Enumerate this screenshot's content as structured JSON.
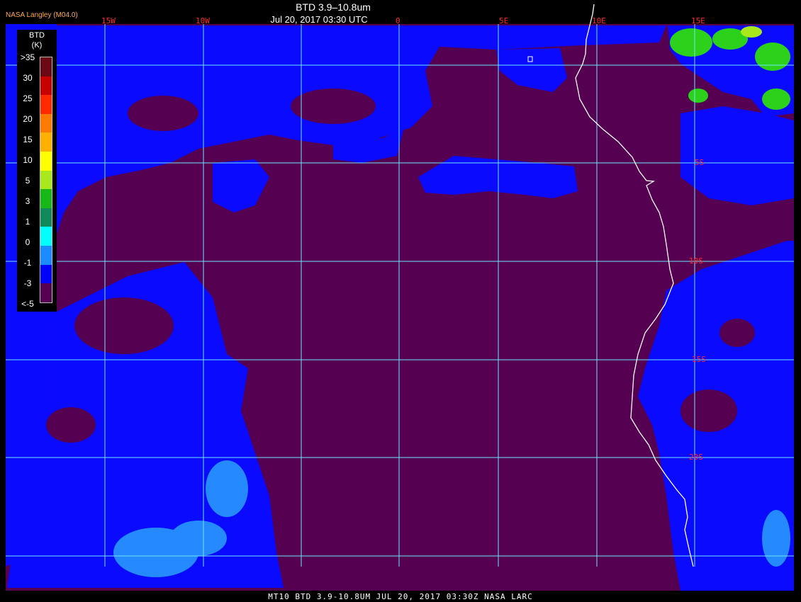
{
  "header": {
    "title": "BTD 3.9–10.8um",
    "subtitle": "Jul 20, 2017 03:30 UTC",
    "credit": "NASA Langley (M04.0)"
  },
  "footer": {
    "text": "MT10  BTD 3.9-10.8UM   JUL 20, 2017 03:30Z   NASA LARC"
  },
  "legend": {
    "title_line1": "BTD",
    "title_line2": "(K)",
    "ticks": [
      ">35",
      "30",
      "25",
      "20",
      "15",
      "10",
      "5",
      "3",
      "1",
      "0",
      "-1",
      "-3",
      "<-5"
    ],
    "colors": [
      "#6b0a14",
      "#c80000",
      "#ff2a00",
      "#ff7a00",
      "#ffb000",
      "#ffff00",
      "#a8e81c",
      "#18b818",
      "#108a5a",
      "#00ffff",
      "#1a8cff",
      "#0000ff",
      "#550050"
    ]
  },
  "map": {
    "lon_labels": [
      "15W",
      "10W",
      "0",
      "5E",
      "10E",
      "15E"
    ],
    "lat_labels": [
      "5S",
      "10S",
      "15S",
      "20S"
    ],
    "colors": {
      "background": "#550050",
      "cold_cloud": "#0a0aff",
      "light_blue": "#2aa0ff",
      "green_cloud": "#2bd11a",
      "grid": "#6fe6ff",
      "label": "#ff2a2a",
      "coast": "#ffffff"
    }
  }
}
